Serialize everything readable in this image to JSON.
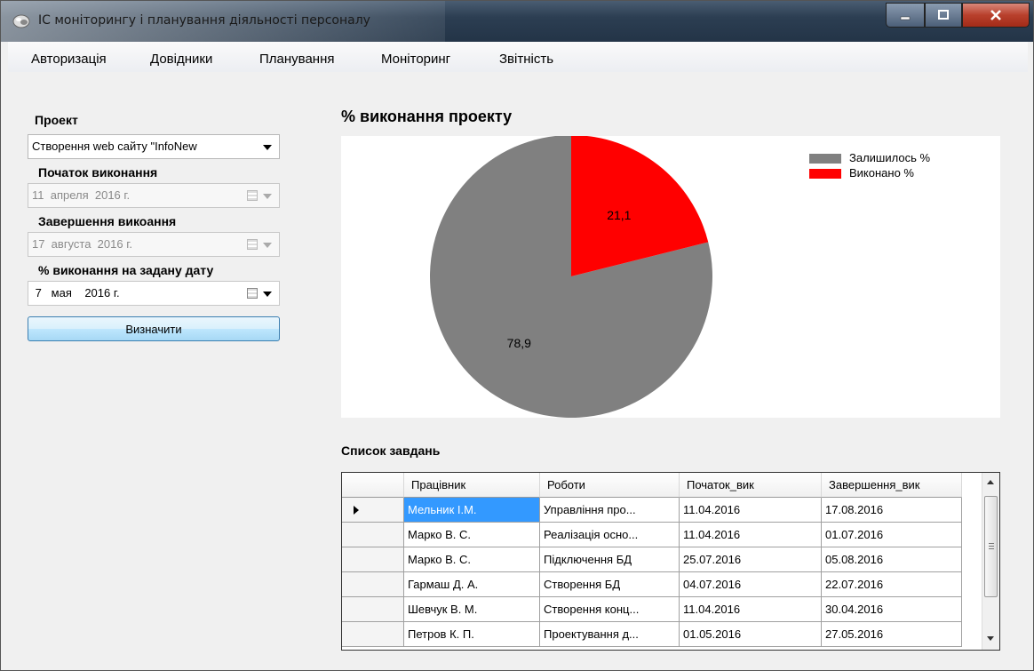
{
  "window": {
    "title": "ІС моніторингу і планування діяльності персоналу"
  },
  "menu": [
    "Авторизація",
    "Довідники",
    "Планування",
    "Моніторинг",
    "Звітність"
  ],
  "form": {
    "project_label": "Проект",
    "project_value": "Створення web сайту \"InfoNew",
    "start_label": "Початок виконання",
    "start_value": "11  апреля  2016 г.",
    "end_label": "Завершення викоання",
    "end_value": "17  августа  2016 г.",
    "date_label": "% виконання на задану дату",
    "date_value": " 7   мая    2016 г.",
    "button": "Визначити"
  },
  "chart_data": {
    "type": "pie",
    "title": "% виконання проекту",
    "slices": [
      {
        "label": "Залишилось %",
        "value": 78.9,
        "value_label": "78,9",
        "color": "#808080"
      },
      {
        "label": "Виконано %",
        "value": 21.1,
        "value_label": "21,1",
        "color": "#ff0000"
      }
    ],
    "legend": "top-right"
  },
  "tasks": {
    "title": "Список завдань",
    "columns": [
      "Працівник",
      "Роботи",
      "Початок_вик",
      "Завершення_вик"
    ],
    "rows": [
      [
        "Мельник І.М.",
        "Управління про...",
        "11.04.2016",
        "17.08.2016"
      ],
      [
        "Марко В. С.",
        "Реалізація осно...",
        "11.04.2016",
        "01.07.2016"
      ],
      [
        "Марко В. С.",
        "Підключення БД",
        "25.07.2016",
        "05.08.2016"
      ],
      [
        "Гармаш Д. А.",
        "Створення БД",
        "04.07.2016",
        "22.07.2016"
      ],
      [
        "Шевчук В. М.",
        "Створення конц...",
        "11.04.2016",
        "30.04.2016"
      ],
      [
        "Петров К. П.",
        "Проектування д...",
        "01.05.2016",
        "27.05.2016"
      ]
    ]
  }
}
